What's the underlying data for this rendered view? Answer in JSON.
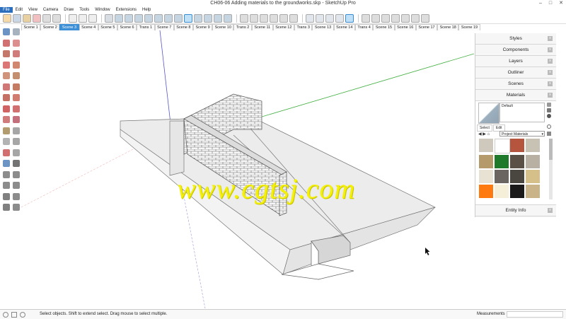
{
  "window": {
    "title": "CH06-06 Adding materials to the groundworks.skp - SketchUp Pro"
  },
  "menu": [
    "File",
    "Edit",
    "View",
    "Camera",
    "Draw",
    "Tools",
    "Window",
    "Extensions",
    "Help"
  ],
  "scene_tabs": [
    "Scene 1",
    "Scene 2",
    "Scene 3",
    "Scene 4",
    "Scene 5",
    "Scene 6",
    "Trans 1",
    "Scene 7",
    "Scene 8",
    "Scene 9",
    "Scene 10",
    "Trans 2",
    "Scene 11",
    "Scene 12",
    "Trans 3",
    "Scene 13",
    "Scene 14",
    "Trans 4",
    "Scene 15",
    "Scene 16",
    "Scene 17",
    "Scene 18",
    "Scene 19"
  ],
  "active_scene": "Scene 3",
  "tray": {
    "panels_top": [
      "Styles",
      "Components",
      "Layers",
      "Outliner",
      "Scenes"
    ],
    "materials": {
      "title": "Materials",
      "name_value": "Default",
      "tabs": [
        "Select",
        "Edit"
      ],
      "library": "Project Materials"
    },
    "entity_info": "Entity Info"
  },
  "watermark": "www.cgtsj.com",
  "status": {
    "hint": "Select objects. Shift to extend select. Drag mouse to select multiple.",
    "measurements_label": "Measurements"
  },
  "colors": {
    "accent": "#2a6ebd",
    "active_tab": "#3d8fd6",
    "watermark": "#f4f00a",
    "axis_red": "#e06060",
    "axis_green": "#3fae3f",
    "axis_blue": "#5555cc"
  },
  "material_swatches": [
    "#cfc9bd",
    "#ffffff",
    "#b5553d",
    "#c8c2b5",
    "#b59a6b",
    "#1e7a2a",
    "#5a5046",
    "#b8b0a2",
    "#e8e2d5",
    "#6a6560",
    "#4a4640",
    "#d6c08a",
    "#ff7a10",
    "#f5efd9",
    "#1a1a1a",
    "#c9b388"
  ]
}
